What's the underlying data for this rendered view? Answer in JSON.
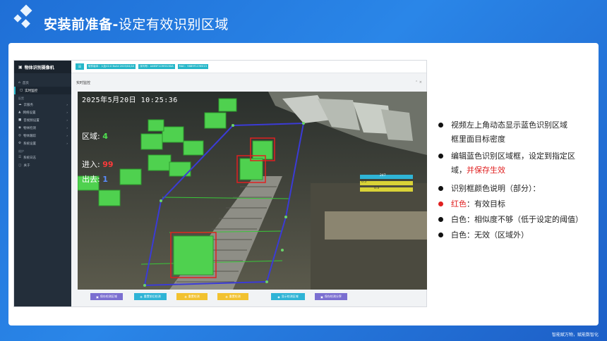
{
  "slide": {
    "title_bold": "安装前准备-",
    "title_rest": "设定有效识别区域",
    "footer": "智能赋万物，赋能数智化"
  },
  "app": {
    "name": "物体识别摄像机",
    "menu_icon": "hamburger-icon",
    "badges": [
      "软件版本：人及V2.0 Build 2025/04/10",
      "序列号：A4B5F1C9E013DA",
      "MAC：98B9F1C9E013"
    ],
    "sidebar": {
      "top_items": [
        {
          "label": "首页",
          "icon": "home-icon"
        },
        {
          "label": "实时监控",
          "icon": "monitor-icon"
        }
      ],
      "section1": "配置",
      "config_items": [
        {
          "label": "云服务",
          "icon": "cloud-icon"
        },
        {
          "label": "网络设置",
          "icon": "network-icon"
        },
        {
          "label": "音视频设置",
          "icon": "video-icon"
        },
        {
          "label": "物体检测",
          "icon": "detect-icon"
        },
        {
          "label": "物体跟踪",
          "icon": "track-icon"
        },
        {
          "label": "系统设置",
          "icon": "settings-icon"
        }
      ],
      "section2": "维护",
      "maint_items": [
        {
          "label": "系统日志",
          "icon": "log-icon"
        },
        {
          "label": "关于",
          "icon": "info-icon"
        }
      ]
    },
    "panel_title": "实时监控",
    "video": {
      "timestamp": "2025年5月20日  10:25:36",
      "zone_label": "区域",
      "zone_value": "4",
      "in_label": "进入",
      "in_value": "99",
      "out_label": "出去",
      "out_value": "1",
      "bars": [
        "247",
        "0.5",
        "0.3"
      ]
    },
    "buttons": [
      {
        "label": "保存检测区域",
        "color": "purple"
      },
      {
        "label": "重置前后检测",
        "color": "cyan"
      },
      {
        "label": "重置检测",
        "color": "yellow"
      },
      {
        "label": "重置检测",
        "color": "yellow"
      },
      {
        "label": "显示检测区域",
        "color": "cyan"
      },
      {
        "label": "保存检测分界",
        "color": "purple"
      }
    ]
  },
  "bullets": [
    {
      "line1": "视频左上角动态显示蓝色识别区域",
      "line2": "框里面目标密度"
    },
    {
      "line1": "编辑蓝色识别区域框，设定到指定区",
      "line2_a": "域，",
      "line2_b": "并保存生效"
    },
    {
      "line1": "识别框颜色说明（部分）："
    },
    {
      "label": "红色",
      "rest": "：有效目标"
    },
    {
      "label": "白色",
      "rest": "：相似度不够（低于设定的阈值）"
    },
    {
      "label": "白色",
      "rest": "：无效（区域外）"
    }
  ],
  "colors": {
    "bg_blue": "#2a86e8",
    "accent_cyan": "#26b7c9",
    "sidebar": "#232e3a",
    "zone_blue": "#3b3bd6",
    "box_red": "#e02020",
    "crate_green": "#4fd14f",
    "highlight_red": "#e02020"
  }
}
